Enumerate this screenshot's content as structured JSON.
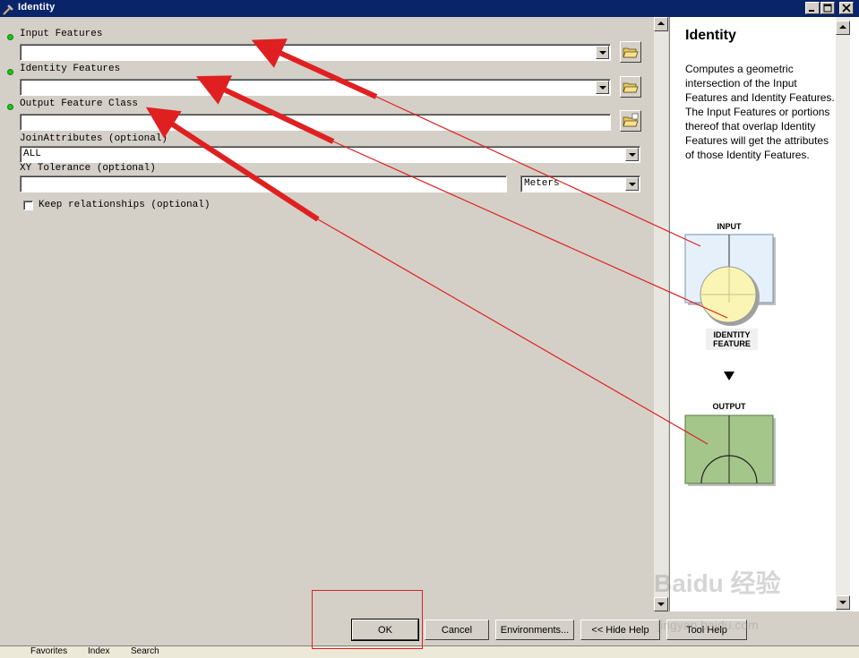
{
  "window": {
    "title": "Identity"
  },
  "params": {
    "input_features": {
      "label": "Input Features",
      "value": ""
    },
    "identity_features": {
      "label": "Identity Features",
      "value": ""
    },
    "output_feature_class": {
      "label": "Output Feature Class",
      "value": ""
    },
    "join_attributes": {
      "label": "JoinAttributes (optional)",
      "value": "ALL"
    },
    "xy_tolerance": {
      "label": "XY Tolerance (optional)",
      "value": "",
      "units": "Meters"
    },
    "keep_relationships": {
      "label": "Keep relationships (optional)",
      "checked": false
    }
  },
  "help": {
    "title": "Identity",
    "description": "Computes a geometric intersection of the Input Features and Identity Features. The Input Features or portions thereof that overlap Identity Features will get the attributes of those Identity Features.",
    "diagram": {
      "input_label": "INPUT",
      "identity_label_line1": "IDENTITY",
      "identity_label_line2": "FEATURE",
      "output_label": "OUTPUT"
    }
  },
  "buttons": {
    "ok": "OK",
    "cancel": "Cancel",
    "environments": "Environments...",
    "hide_help": "<< Hide Help",
    "tool_help": "Tool Help"
  },
  "taskbar": {
    "item1": "Favorites",
    "item2": "Index",
    "item3": "Search"
  },
  "watermark": {
    "brand": "Baidu 经验",
    "url": "jingyan.baidu.com"
  },
  "colors": {
    "titlebar": "#0a246a",
    "annotation_red": "#e02020",
    "required_dot": "#1cc31c",
    "input_fill": "#e6f0fa",
    "identity_fill": "#fbf5b4",
    "output_fill": "#a4c68a"
  }
}
